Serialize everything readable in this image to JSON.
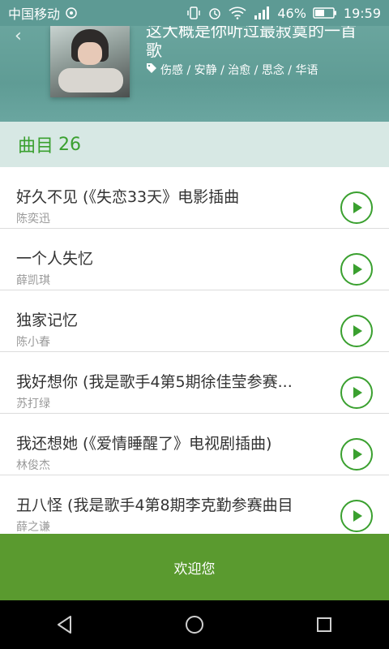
{
  "status_bar": {
    "carrier": "中国移动",
    "battery": "46%",
    "time": "19:59"
  },
  "header": {
    "title": "这大概是你听过最寂寞的一首歌",
    "tags": "伤感 / 安静 / 治愈 / 思念 / 华语"
  },
  "tracks_header": {
    "label": "曲目",
    "count": "26"
  },
  "tracks": [
    {
      "title": "好久不见 (《失恋33天》电影插曲",
      "artist": "陈奕迅"
    },
    {
      "title": "一个人失忆",
      "artist": "薛凯琪"
    },
    {
      "title": "独家记忆",
      "artist": "陈小春"
    },
    {
      "title": "我好想你 (我是歌手4第5期徐佳莹参赛...",
      "artist": "苏打绿"
    },
    {
      "title": "我还想她 (《爱情睡醒了》电视剧插曲)",
      "artist": "林俊杰"
    },
    {
      "title": "丑八怪 (我是歌手4第8期李克勤参赛曲目",
      "artist": "薛之谦"
    }
  ],
  "footer": {
    "welcome": "欢迎您"
  },
  "colors": {
    "accent": "#3aa02f",
    "header_bg": "#5f9c95",
    "band_bg": "#d7e8e4",
    "footer_bg": "#5a9a2f"
  },
  "icons": [
    "back-arrow-icon",
    "tag-icon",
    "play-icon",
    "nav-back-icon",
    "nav-home-icon",
    "nav-recents-icon"
  ]
}
